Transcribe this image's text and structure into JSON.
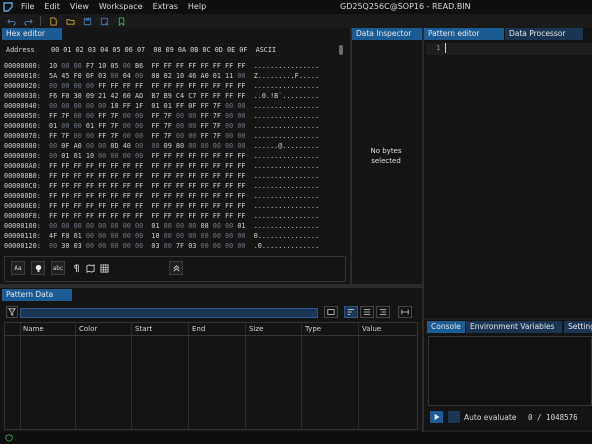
{
  "menubar": {
    "items": [
      "File",
      "Edit",
      "View",
      "Workspace",
      "Extras",
      "Help"
    ],
    "title": "GD25Q256C@SOP16 - READ.BIN"
  },
  "toolbar": {
    "icons": [
      "undo-icon",
      "redo-icon",
      "new-file-icon",
      "open-file-icon",
      "save-icon",
      "save-as-icon",
      "bookmark-icon"
    ]
  },
  "hex_editor": {
    "tab": "Hex editor",
    "header": "Address    00 01 02 03 04 05 06 07  08 09 0A 0B 0C 0D 0E 0F  ASCII",
    "rows": [
      {
        "addr": "00000000:",
        "bytes": [
          "10",
          "00",
          "00",
          "F7",
          "10",
          "05",
          "00",
          "B6",
          "FF",
          "FF",
          "FF",
          "FF",
          "FF",
          "FF",
          "FF",
          "FF"
        ],
        "ascii": "................"
      },
      {
        "addr": "00000010:",
        "bytes": [
          "5A",
          "45",
          "F0",
          "0F",
          "03",
          "00",
          "04",
          "00",
          "08",
          "02",
          "10",
          "46",
          "A0",
          "01",
          "11",
          "00"
        ],
        "ascii": "Z.........F....."
      },
      {
        "addr": "00000020:",
        "bytes": [
          "00",
          "00",
          "00",
          "00",
          "FF",
          "FF",
          "FF",
          "FF",
          "FF",
          "FF",
          "FF",
          "FF",
          "FF",
          "FF",
          "FF",
          "FF"
        ],
        "ascii": "................"
      },
      {
        "addr": "00000030:",
        "bytes": [
          "F6",
          "F0",
          "30",
          "09",
          "21",
          "42",
          "60",
          "AD",
          "B7",
          "B9",
          "C4",
          "C7",
          "FF",
          "FF",
          "FF",
          "FF"
        ],
        "ascii": "..0.!B`........."
      },
      {
        "addr": "00000040:",
        "bytes": [
          "00",
          "00",
          "00",
          "00",
          "00",
          "10",
          "FF",
          "1F",
          "01",
          "01",
          "FF",
          "0F",
          "FF",
          "7F",
          "00",
          "00"
        ],
        "ascii": "................"
      },
      {
        "addr": "00000050:",
        "bytes": [
          "FF",
          "7F",
          "00",
          "00",
          "FF",
          "7F",
          "00",
          "00",
          "FF",
          "7F",
          "00",
          "00",
          "FF",
          "7F",
          "00",
          "00"
        ],
        "ascii": "................"
      },
      {
        "addr": "00000060:",
        "bytes": [
          "01",
          "00",
          "00",
          "01",
          "FF",
          "7F",
          "00",
          "00",
          "FF",
          "7F",
          "00",
          "00",
          "FF",
          "7F",
          "00",
          "00"
        ],
        "ascii": "................"
      },
      {
        "addr": "00000070:",
        "bytes": [
          "FF",
          "7F",
          "00",
          "00",
          "FF",
          "7F",
          "00",
          "00",
          "FF",
          "7F",
          "00",
          "00",
          "FF",
          "7F",
          "00",
          "00"
        ],
        "ascii": "................"
      },
      {
        "addr": "00000080:",
        "bytes": [
          "00",
          "0F",
          "A0",
          "00",
          "00",
          "0D",
          "40",
          "00",
          "00",
          "09",
          "80",
          "00",
          "00",
          "00",
          "00",
          "00"
        ],
        "ascii": "......@........."
      },
      {
        "addr": "00000090:",
        "bytes": [
          "00",
          "01",
          "01",
          "10",
          "00",
          "00",
          "00",
          "00",
          "FF",
          "FF",
          "FF",
          "FF",
          "FF",
          "FF",
          "FF",
          "FF"
        ],
        "ascii": "................"
      },
      {
        "addr": "000000A0:",
        "bytes": [
          "FF",
          "FF",
          "FF",
          "FF",
          "FF",
          "FF",
          "FF",
          "FF",
          "FF",
          "FF",
          "FF",
          "FF",
          "FF",
          "FF",
          "FF",
          "FF"
        ],
        "ascii": "................"
      },
      {
        "addr": "000000B0:",
        "bytes": [
          "FF",
          "FF",
          "FF",
          "FF",
          "FF",
          "FF",
          "FF",
          "FF",
          "FF",
          "FF",
          "FF",
          "FF",
          "FF",
          "FF",
          "FF",
          "FF"
        ],
        "ascii": "................"
      },
      {
        "addr": "000000C0:",
        "bytes": [
          "FF",
          "FF",
          "FF",
          "FF",
          "FF",
          "FF",
          "FF",
          "FF",
          "FF",
          "FF",
          "FF",
          "FF",
          "FF",
          "FF",
          "FF",
          "FF"
        ],
        "ascii": "................"
      },
      {
        "addr": "000000D0:",
        "bytes": [
          "FF",
          "FF",
          "FF",
          "FF",
          "FF",
          "FF",
          "FF",
          "FF",
          "FF",
          "FF",
          "FF",
          "FF",
          "FF",
          "FF",
          "FF",
          "FF"
        ],
        "ascii": "................"
      },
      {
        "addr": "000000E0:",
        "bytes": [
          "FF",
          "FF",
          "FF",
          "FF",
          "FF",
          "FF",
          "FF",
          "FF",
          "FF",
          "FF",
          "FF",
          "FF",
          "FF",
          "FF",
          "FF",
          "FF"
        ],
        "ascii": "................"
      },
      {
        "addr": "000000F0:",
        "bytes": [
          "FF",
          "FF",
          "FF",
          "FF",
          "FF",
          "FF",
          "FF",
          "FF",
          "FF",
          "FF",
          "FF",
          "FF",
          "FF",
          "FF",
          "FF",
          "FF"
        ],
        "ascii": "................"
      },
      {
        "addr": "00000100:",
        "bytes": [
          "00",
          "00",
          "00",
          "00",
          "00",
          "00",
          "00",
          "00",
          "01",
          "00",
          "00",
          "00",
          "08",
          "00",
          "00",
          "01"
        ],
        "ascii": "................"
      },
      {
        "addr": "00000110:",
        "bytes": [
          "4F",
          "F8",
          "01",
          "00",
          "00",
          "00",
          "00",
          "00",
          "10",
          "00",
          "00",
          "00",
          "00",
          "00",
          "00",
          "00"
        ],
        "ascii": "0..............."
      },
      {
        "addr": "00000120:",
        "bytes": [
          "00",
          "30",
          "03",
          "00",
          "00",
          "00",
          "00",
          "00",
          "03",
          "00",
          "7F",
          "03",
          "00",
          "00",
          "00",
          "00"
        ],
        "ascii": ".0.............."
      }
    ],
    "footer_labels": [
      "Aa",
      "abc"
    ]
  },
  "data_inspector": {
    "tab": "Data Inspector",
    "message_line1": "No bytes",
    "message_line2": "selected"
  },
  "pattern_editor": {
    "tabs": [
      "Pattern editor",
      "Data Processor"
    ],
    "line_number": "1"
  },
  "pattern_data": {
    "tab": "Pattern Data",
    "columns": [
      "Name",
      "Color",
      "Start",
      "End",
      "Size",
      "Type",
      "Value"
    ]
  },
  "console": {
    "tabs": [
      "Console",
      "Environment Variables",
      "Settings"
    ],
    "auto_evaluate": "Auto evaluate",
    "position": "0 / 1048576"
  },
  "colors": {
    "accent": "#1c5c95",
    "tab_inactive": "#1b3552",
    "zero_byte": "#6c7480"
  }
}
